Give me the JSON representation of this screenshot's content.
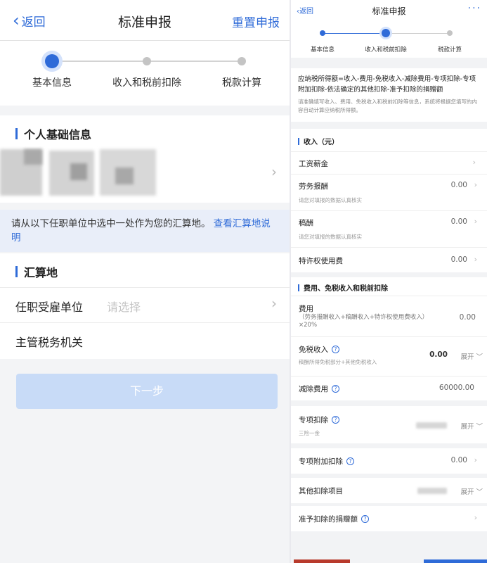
{
  "left": {
    "nav": {
      "back_label": "返回",
      "title": "标准申报",
      "reset_label": "重置申报"
    },
    "steps": [
      "基本信息",
      "收入和税前扣除",
      "税款计算"
    ],
    "personal_section_title": "个人基础信息",
    "tip": {
      "text": "请从以下任职单位中选中一处作为您的汇算地。",
      "link": "查看汇算地说明"
    },
    "settlement_section_title": "汇算地",
    "employer": {
      "label": "任职受雇单位",
      "placeholder": "请选择"
    },
    "tax_office": {
      "label": "主管税务机关"
    },
    "next_label": "下一步"
  },
  "right": {
    "nav": {
      "back_label": "返回",
      "title": "标准申报",
      "more_label": "···"
    },
    "steps": [
      "基本信息",
      "收入和税前扣除",
      "税款计算"
    ],
    "formula": "应纳税所得额=收入-费用-免税收入-减除费用-专项扣除-专项附加扣除-依法确定的其他扣除-准予扣除的捐赠额",
    "formula_hint": "请准确填写收入、费用、免税收入和税前扣除等信息，系统将根据您填写的内容自动计算应纳税所得额。",
    "income_section": "收入（元）",
    "income": {
      "salary": {
        "label": "工资薪金"
      },
      "labor": {
        "label": "劳务报酬",
        "hint": "请您对填报的数据认真核实",
        "value": "0.00"
      },
      "royalty": {
        "label": "稿酬",
        "hint": "请您对填报的数据认真核实",
        "value": "0.00"
      },
      "franchise": {
        "label": "特许权使用费",
        "value": "0.00"
      }
    },
    "deduction_section": "费用、免税收入和税前扣除",
    "fee": {
      "label": "费用",
      "hint": "（劳务报酬收入+稿酬收入+特许权使用费收入）×20%",
      "value": "0.00"
    },
    "tax_free": {
      "label": "免税收入",
      "hint": "稿酬所得免税部分+其他免税收入",
      "value": "0.00",
      "expand": "展开"
    },
    "reduction": {
      "label": "减除费用",
      "value": "60000.00"
    },
    "special": {
      "label": "专项扣除",
      "hint": "三险一金",
      "expand": "展开"
    },
    "special_additional": {
      "label": "专项附加扣除",
      "value": "0.00"
    },
    "other": {
      "label": "其他扣除项目",
      "expand": "展开"
    },
    "donation": {
      "label": "准予扣除的捐赠额"
    }
  },
  "colors": {
    "accent": "#2f6bd8",
    "tip_bg": "#e9eef9",
    "disabled_button": "#c8dbf7"
  }
}
